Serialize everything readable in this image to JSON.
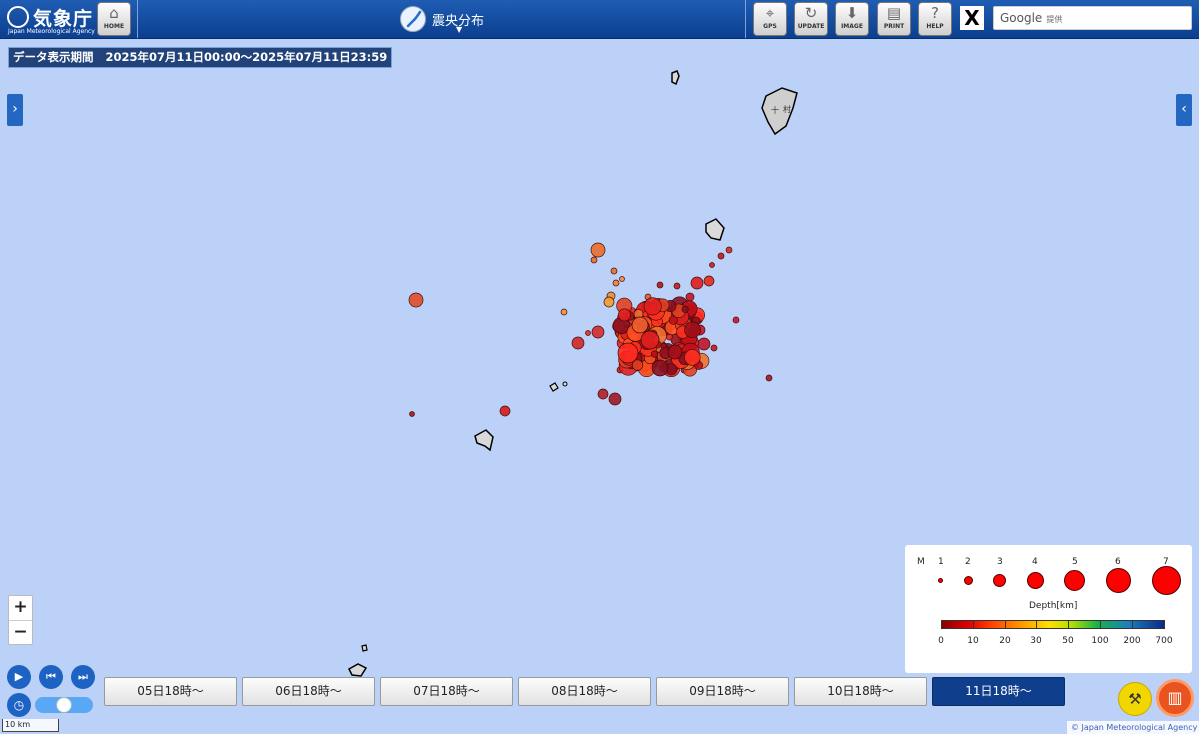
{
  "header": {
    "logo_jp": "気象庁",
    "logo_en": "Japan Meteorological Agency",
    "home_label": "HOME",
    "title": "震央分布",
    "gps_label": "GPS",
    "update_label": "UPDATE",
    "image_label": "IMAGE",
    "print_label": "PRINT",
    "help_label": "HELP",
    "x_label": "X",
    "search_brand": "Google",
    "search_suffix": "提供"
  },
  "period": {
    "label": "データ表示期間",
    "range": "2025年07月11日00:00～2025年07月11日23:59"
  },
  "map": {
    "background": "#bcd1f7",
    "zoom_in": "+",
    "zoom_out": "−",
    "scale": "10 km",
    "copyright": "© Japan Meteorological Agency",
    "island_labels": [
      "十",
      "村"
    ]
  },
  "playback": {
    "play": "▶",
    "prev": "⏮",
    "next": "⏭"
  },
  "day_buttons": [
    {
      "label": "05日18時～",
      "active": false
    },
    {
      "label": "06日18時～",
      "active": false
    },
    {
      "label": "07日18時～",
      "active": false
    },
    {
      "label": "08日18時～",
      "active": false
    },
    {
      "label": "09日18時～",
      "active": false
    },
    {
      "label": "10日18時～",
      "active": false
    },
    {
      "label": "11日18時～",
      "active": true
    }
  ],
  "legend": {
    "m_label": "M",
    "magnitudes": [
      "1",
      "2",
      "3",
      "4",
      "5",
      "6",
      "7"
    ],
    "depth_title": "Depth[km]",
    "depth_ticks": [
      "0",
      "10",
      "20",
      "30",
      "50",
      "100",
      "200",
      "700"
    ],
    "symbol_color": "#ff0000"
  },
  "icons": {
    "home": "home-icon",
    "gps": "gps-icon",
    "update": "update-icon",
    "image": "download-icon",
    "print": "print-icon",
    "help": "help-icon",
    "tool": "tool-icon",
    "book": "book-icon"
  }
}
